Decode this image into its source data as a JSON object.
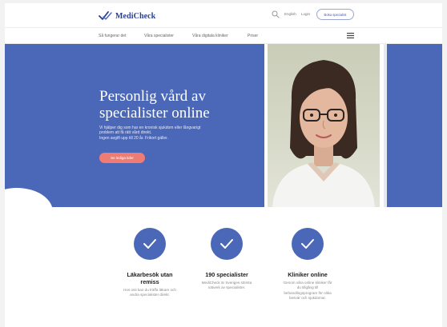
{
  "header": {
    "logo_text": "MediCheck",
    "language": "English",
    "login": "Login",
    "book_button": "Boka specialist"
  },
  "nav": {
    "items": [
      {
        "label": "Så fungerar det"
      },
      {
        "label": "Våra specialister"
      },
      {
        "label": "Våra digitala kliniker"
      },
      {
        "label": "Priser"
      }
    ]
  },
  "hero": {
    "title_line1": "Personlig vård av",
    "title_line2": "specialister online",
    "text_line1": "Vi hjälper dig som har en kronisk sjukdom eller långvarigt",
    "text_line2": "problem att få rätt vård direkt.",
    "text_line3": "Ingen avgift upp till 20 år. Frikort gäller.",
    "cta": "Se lediga tider"
  },
  "features": [
    {
      "title_line1": "Läkarbesök utan",
      "title_line2": "remiss",
      "desc_line1": "Hos oss kan du träffa läkare och",
      "desc_line2": "andra specialister direkt.",
      "desc_line3": "",
      "desc_line4": ""
    },
    {
      "title_line1": "190 specialister",
      "title_line2": "",
      "desc_line1": "MediCheck är Sveriges största",
      "desc_line2": "nätverk av specialister.",
      "desc_line3": "",
      "desc_line4": ""
    },
    {
      "title_line1": "Kliniker online",
      "title_line2": "",
      "desc_line1": "Genom våra online kliniker får",
      "desc_line2": "du tillgång till",
      "desc_line3": "behandlingsprogram för olika",
      "desc_line4": "besvär och sjukdomar."
    }
  ],
  "colors": {
    "brand_blue": "#4a67b8",
    "accent_coral": "#ef7c74"
  }
}
